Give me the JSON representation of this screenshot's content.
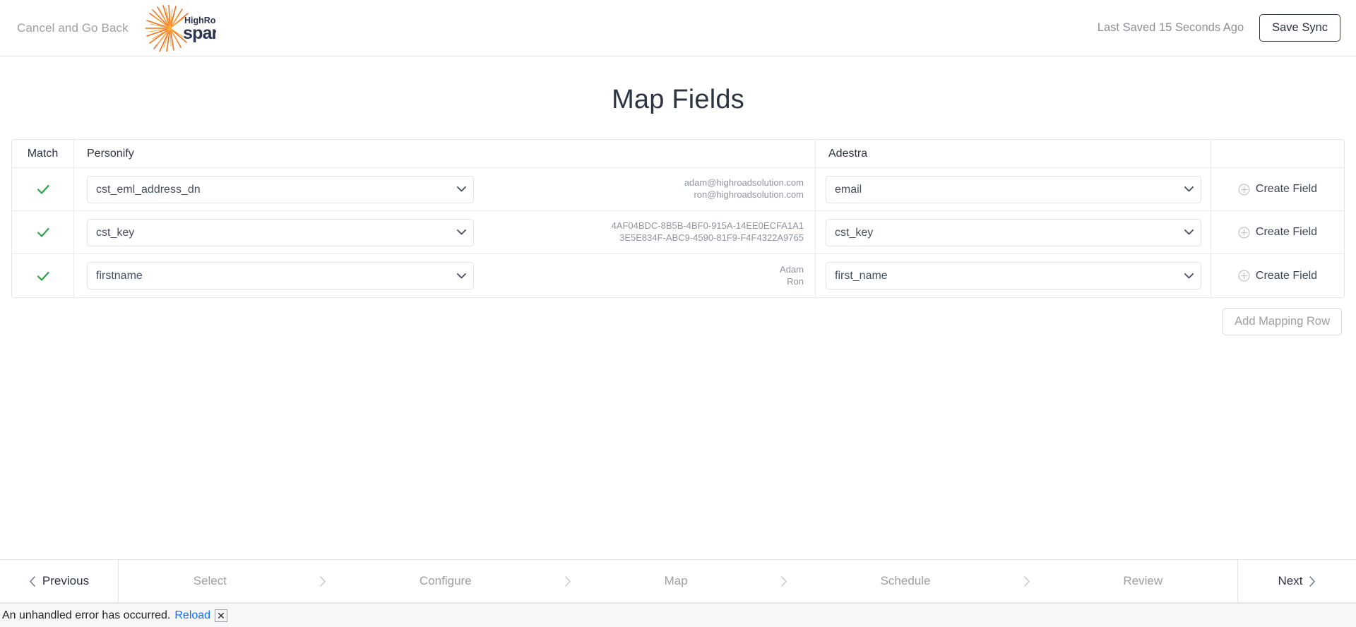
{
  "header": {
    "cancel_label": "Cancel and Go Back",
    "logo_top_text": "HighRoad",
    "logo_main_text": "spark",
    "last_saved": "Last Saved 15 Seconds Ago",
    "save_button": "Save Sync",
    "logo_burst_color": "#f37021",
    "logo_text_color": "#2b3352"
  },
  "page": {
    "title": "Map Fields"
  },
  "table": {
    "columns": {
      "match": "Match",
      "source": "Personify",
      "target": "Adestra",
      "action": ""
    },
    "rows": [
      {
        "matched": true,
        "match_icon": "check-icon",
        "source_field": "cst_eml_address_dn",
        "samples": [
          "adam@highroadsolution.com",
          "ron@highroadsolution.com"
        ],
        "target_field": "email",
        "create_field_label": "Create Field"
      },
      {
        "matched": true,
        "match_icon": "check-icon",
        "source_field": "cst_key",
        "samples": [
          "4AF04BDC-8B5B-4BF0-915A-14EE0ECFA1A1",
          "3E5E834F-ABC9-4590-81F9-F4F4322A9765"
        ],
        "target_field": "cst_key",
        "create_field_label": "Create Field"
      },
      {
        "matched": true,
        "match_icon": "check-icon",
        "source_field": "firstname",
        "samples": [
          "Adam",
          "Ron"
        ],
        "target_field": "first_name",
        "create_field_label": "Create Field"
      }
    ],
    "add_mapping_row_label": "Add Mapping Row",
    "check_color": "#27a745"
  },
  "footer": {
    "previous_label": "Previous",
    "next_label": "Next",
    "steps": [
      {
        "label": "Select"
      },
      {
        "label": "Configure"
      },
      {
        "label": "Map"
      },
      {
        "label": "Schedule"
      },
      {
        "label": "Review"
      }
    ],
    "separator_icon": "chevron-right-icon"
  },
  "error_bar": {
    "message": "An unhandled error has occurred.",
    "reload_label": "Reload",
    "dismiss_label": "✕",
    "link_color": "#0d6efd"
  }
}
